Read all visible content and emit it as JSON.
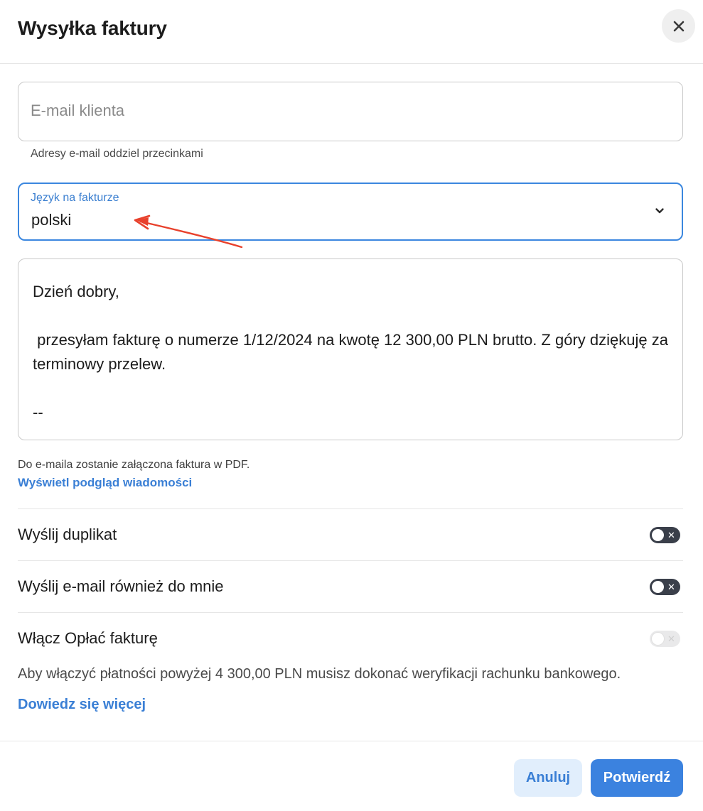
{
  "dialog": {
    "title": "Wysyłka faktury",
    "close_icon": "close-icon"
  },
  "email": {
    "placeholder": "E-mail klienta",
    "value": "",
    "helper": "Adresy e-mail oddziel przecinkami"
  },
  "language": {
    "label": "Język na fakturze",
    "value": "polski",
    "chevron_icon": "chevron-down-icon"
  },
  "message": {
    "greeting": "Dzień dobry,",
    "body": " przesyłam fakturę o numerze 1/12/2024 na kwotę 12 300,00 PLN brutto. Z góry dziękuję za terminowy przelew.",
    "signature": "--"
  },
  "attachment": {
    "note": "Do e-maila zostanie załączona faktura w PDF.",
    "preview_link": "Wyświetl podgląd wiadomości"
  },
  "options": [
    {
      "label": "Wyślij duplikat",
      "enabled": false,
      "disabled": false
    },
    {
      "label": "Wyślij e-mail również do mnie",
      "enabled": false,
      "disabled": false
    },
    {
      "label": "Włącz Opłać fakturę",
      "enabled": false,
      "disabled": true
    }
  ],
  "payment": {
    "note": "Aby włączyć płatności powyżej 4 300,00 PLN musisz dokonać weryfikacji rachunku bankowego.",
    "learn_more": "Dowiedz się więcej"
  },
  "footer": {
    "cancel_label": "Anuluj",
    "confirm_label": "Potwierdź"
  },
  "colors": {
    "accent": "#3b82df",
    "link": "#3a7fd5",
    "annotation_arrow": "#e8412c",
    "toggle_off": "#3a3f4a"
  }
}
